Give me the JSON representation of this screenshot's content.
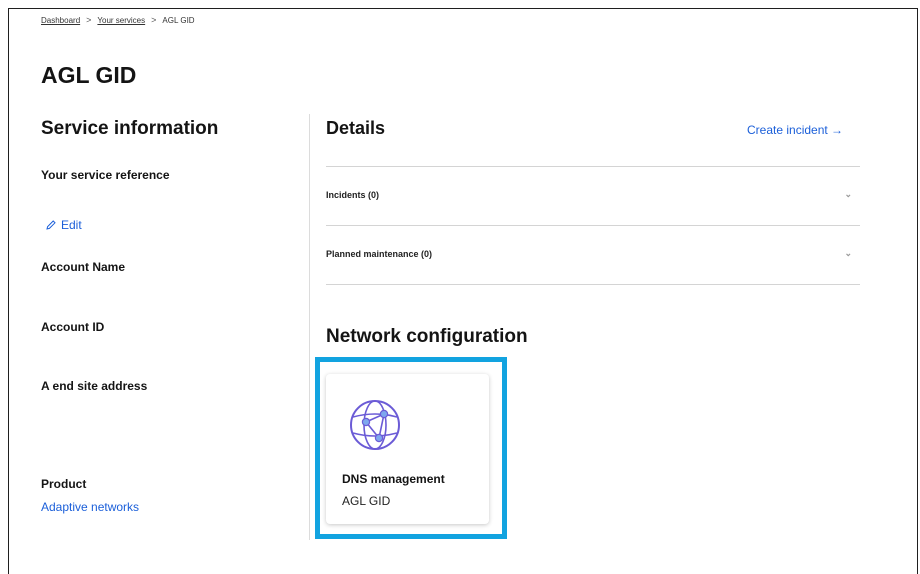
{
  "breadcrumb": {
    "items": [
      "Dashboard",
      "Your services",
      "AGL GID"
    ],
    "separator": ">"
  },
  "page": {
    "title": "AGL GID"
  },
  "service_info": {
    "heading": "Service information",
    "reference_label": "Your service reference",
    "edit_label": "Edit",
    "account_name_label": "Account Name",
    "account_id_label": "Account ID",
    "a_end_label": "A end site address",
    "product_label": "Product",
    "product_value": "Adaptive networks"
  },
  "details": {
    "heading": "Details",
    "create_incident": "Create incident →",
    "accordions": [
      {
        "label": "Incidents (0)"
      },
      {
        "label": "Planned maintenance (0)"
      }
    ]
  },
  "network_configuration": {
    "heading": "Network configuration",
    "card": {
      "icon": "globe-network-icon",
      "title": "DNS management",
      "subtitle": "AGL GID"
    }
  },
  "colors": {
    "link": "#1b5fd9",
    "highlight": "#12a3e0",
    "icon": "#6b5bd6"
  }
}
